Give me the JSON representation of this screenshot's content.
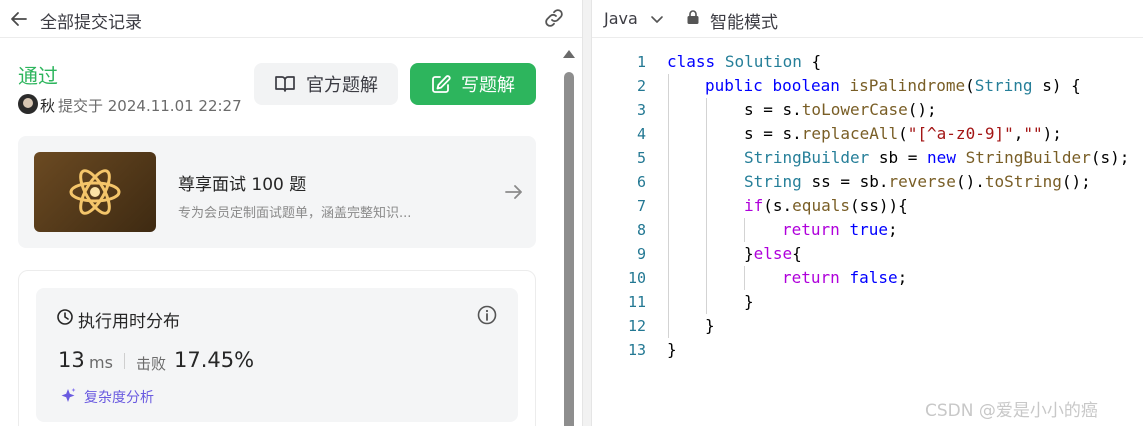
{
  "left_panel": {
    "header": {
      "title": "全部提交记录",
      "back_icon": "arrow-left-icon",
      "link_icon": "link-icon"
    },
    "submission": {
      "status": "通过",
      "author": "秋",
      "submitted_at": "提交于 2024.11.01 22:27",
      "status_color": "#2db55d"
    },
    "buttons": {
      "official_solution": "官方题解",
      "write_solution": "写题解"
    },
    "promo": {
      "title": "尊享面试 100 题",
      "description": "专为会员定制面试题单，涵盖完整知识..."
    },
    "performance": {
      "title": "执行用时分布",
      "runtime_value": "13",
      "runtime_unit": "ms",
      "beats_label": "击败",
      "beats_value": "17.45%",
      "complexity_label": "复杂度分析"
    }
  },
  "right_panel": {
    "language": "Java",
    "mode": "智能模式",
    "code_lines": [
      {
        "n": "1"
      },
      {
        "n": "2"
      },
      {
        "n": "3"
      },
      {
        "n": "4"
      },
      {
        "n": "5"
      },
      {
        "n": "6"
      },
      {
        "n": "7"
      },
      {
        "n": "8"
      },
      {
        "n": "9"
      },
      {
        "n": "10"
      },
      {
        "n": "11"
      },
      {
        "n": "12"
      },
      {
        "n": "13"
      }
    ],
    "tokens": {
      "l1": [
        "class",
        "Solution",
        "{"
      ],
      "l2": [
        "public",
        "boolean",
        "isPalindrome",
        "(",
        "String",
        "s) {"
      ],
      "l3": [
        "s = s.",
        "toLowerCase",
        "();"
      ],
      "l4": [
        "s = s.",
        "replaceAll",
        "(",
        "\"[^a-z0-9]\"",
        ",",
        "\"\"",
        ");"
      ],
      "l5": [
        "StringBuilder",
        "sb = ",
        "new",
        "StringBuilder",
        "(s);"
      ],
      "l6": [
        "String",
        "ss = sb.",
        "reverse",
        "().",
        "toString",
        "();"
      ],
      "l7": [
        "if",
        "(s.",
        "equals",
        "(ss)){"
      ],
      "l8": [
        "return",
        "true",
        ";"
      ],
      "l9": [
        "}",
        "else",
        "{"
      ],
      "l10": [
        "return",
        "false",
        ";"
      ],
      "l11": [
        "}"
      ],
      "l12": [
        "}"
      ],
      "l13": [
        "}"
      ]
    }
  },
  "watermark": "CSDN @爱是小小的癌"
}
